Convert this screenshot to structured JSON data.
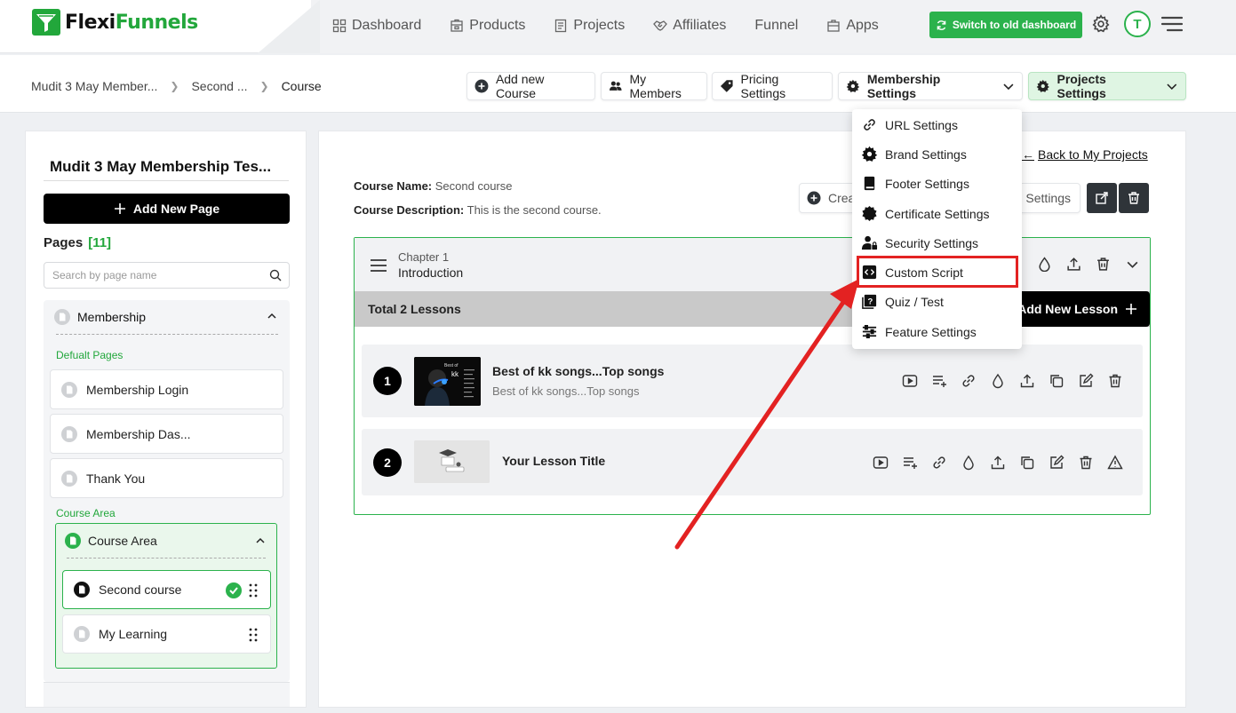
{
  "brand": {
    "name_part1": "Flexi",
    "name_part2": "Funnels",
    "accent": "#2bb24c"
  },
  "nav": {
    "links": [
      {
        "label": "Dashboard",
        "icon": "grid-icon"
      },
      {
        "label": "Products",
        "icon": "box-icon"
      },
      {
        "label": "Projects",
        "icon": "document-icon"
      },
      {
        "label": "Affiliates",
        "icon": "handshake-icon"
      },
      {
        "label": "Funnel",
        "icon": "funnel-icon"
      },
      {
        "label": "Apps",
        "icon": "apps-icon"
      }
    ],
    "switch_label": "Switch to old dashboard",
    "avatar_letter": "T"
  },
  "breadcrumb": {
    "items": [
      "Mudit 3 May Member...",
      "Second ...",
      "Course"
    ]
  },
  "toolbar": {
    "add_course": "Add new Course",
    "my_members": "My Members",
    "pricing": "Pricing Settings",
    "membership": "Membership Settings",
    "projects": "Projects Settings"
  },
  "sidebar": {
    "title": "Mudit 3 May Membership Tes...",
    "add_page": "Add New Page",
    "pages_label": "Pages",
    "pages_count": "[11]",
    "search_placeholder": "Search by page name",
    "group_name": "Membership",
    "default_label": "Defualt Pages",
    "default_pages": [
      "Membership Login",
      "Membership Das...",
      "Thank You"
    ],
    "course_area_label": "Course Area",
    "course_area_title": "Course Area",
    "course_items": [
      "Second course",
      "My Learning"
    ]
  },
  "main": {
    "back_link": "Back to My Projects",
    "course_name_label": "Course Name:",
    "course_name": "Second course",
    "course_desc_label": "Course Description:",
    "course_desc": "This is the second course.",
    "create_partial": "Crea",
    "settings_partial": "e Settings",
    "chapter_num": "Chapter 1",
    "chapter_name": "Introduction",
    "total_lessons": "Total 2 Lessons",
    "add_lesson": "Add New Lesson",
    "lessons": [
      {
        "num": "1",
        "title": "Best of kk songs...Top songs",
        "subtitle": "Best of kk songs...Top songs"
      },
      {
        "num": "2",
        "title": "Your Lesson Title",
        "subtitle": ""
      }
    ],
    "thumb1_text": {
      "line1": "Best of",
      "line2": "kk"
    }
  },
  "dropdown": {
    "items": [
      {
        "label": "URL Settings",
        "icon": "link-icon"
      },
      {
        "label": "Brand Settings",
        "icon": "gear-icon"
      },
      {
        "label": "Footer Settings",
        "icon": "book-icon"
      },
      {
        "label": "Certificate Settings",
        "icon": "badge-icon"
      },
      {
        "label": "Security Settings",
        "icon": "user-lock-icon"
      },
      {
        "label": "Custom Script",
        "icon": "code-icon"
      },
      {
        "label": "Quiz / Test",
        "icon": "quiz-icon"
      },
      {
        "label": "Feature Settings",
        "icon": "sliders-icon"
      }
    ],
    "highlighted": "Custom Script",
    "highlight_color": "#e32222"
  }
}
